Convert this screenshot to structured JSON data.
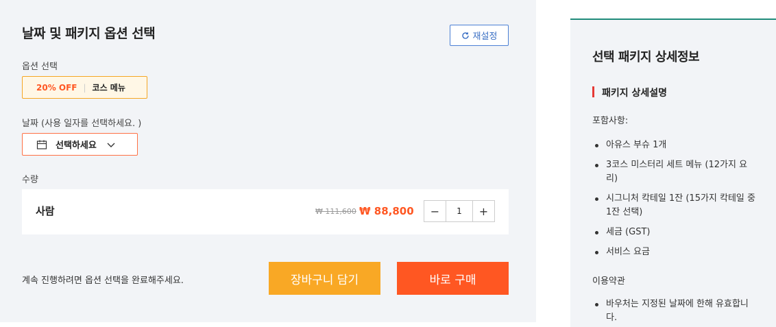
{
  "main": {
    "title": "날짜 및 패키지 옵션 선택",
    "reset_label": "재설정",
    "option_section_label": "옵션 선택",
    "option": {
      "discount": "20% OFF",
      "separator": "|",
      "name": "코스 메뉴"
    },
    "date_section_label": "날짜 (사용 일자를 선택하세요. )",
    "date_select_value": "선택하세요",
    "quantity_section_label": "수량",
    "quantity_row": {
      "type_label": "사람",
      "original_price": "₩ 111,600",
      "sale_price": "₩ 88,800",
      "minus": "−",
      "quantity": "1",
      "plus": "+"
    },
    "notice": "계속 진행하려면 옵션 선택을 완료해주세요.",
    "cart_button": "장바구니 담기",
    "buy_button": "바로 구매"
  },
  "detail": {
    "title": "선택 패키지 상세정보",
    "subtitle": "패키지 상세설명",
    "includes_label": "포함사항:",
    "includes": [
      "아유스 부슈 1개",
      "3코스 미스터리 세트 메뉴 (12가지 요리)",
      "시그니처 칵테일 1잔 (15가지 칵테일 중 1잔 선택)",
      "세금 (GST)",
      "서비스 요금"
    ],
    "terms_label": "이용약관",
    "terms": [
      "바우처는 지정된 날짜에 한해 유효합니다."
    ]
  },
  "colors": {
    "accent_orange": "#ff5722",
    "cart_yellow": "#f9a825",
    "reset_blue": "#3a6fc4",
    "panel_border_teal": "#1f8a7a"
  }
}
